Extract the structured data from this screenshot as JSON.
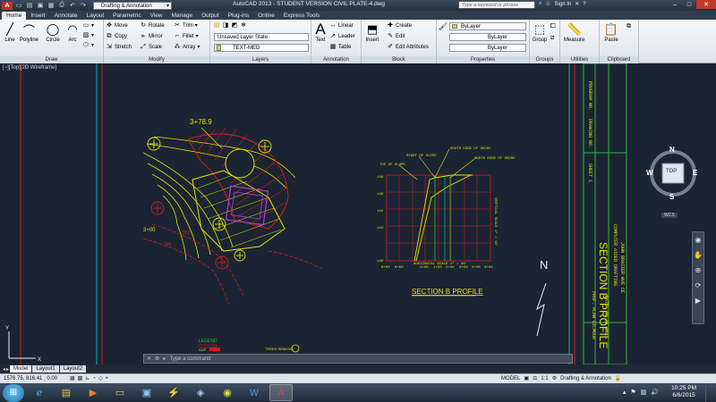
{
  "titlebar": {
    "title": "AutoCAD 2013 - STUDENT VERSION   CIVIL PLATE-4.dwg",
    "workspace": "Drafting & Annotation",
    "search_placeholder": "Type a keyword or phrase",
    "sign_in": "Sign In"
  },
  "tabs": [
    "Home",
    "Insert",
    "Annotate",
    "Layout",
    "Parametric",
    "View",
    "Manage",
    "Output",
    "Plug-ins",
    "Online",
    "Express Tools"
  ],
  "ribbon": {
    "draw": {
      "title": "Draw",
      "line": "Line",
      "polyline": "Polyline",
      "circle": "Circle",
      "arc": "Arc"
    },
    "modify": {
      "title": "Modify",
      "move": "Move",
      "rotate": "Rotate",
      "trim": "Trim",
      "copy": "Copy",
      "mirror": "Mirror",
      "fillet": "Fillet",
      "stretch": "Stretch",
      "scale": "Scale",
      "array": "Array"
    },
    "layers": {
      "title": "Layers",
      "state": "Unsaved Layer State",
      "current": "TEXT-MED"
    },
    "annotation": {
      "title": "Annotation",
      "text": "Text",
      "linear": "Linear",
      "leader": "Leader",
      "table": "Table"
    },
    "block": {
      "title": "Block",
      "insert": "Insert",
      "create": "Create",
      "edit": "Edit",
      "edit_attributes": "Edit Attributes"
    },
    "properties": {
      "title": "Properties",
      "color": "ByLayer",
      "linetype": "ByLayer",
      "lineweight": "ByLayer"
    },
    "groups": {
      "title": "Groups",
      "group": "Group"
    },
    "utilities": {
      "title": "Utilities",
      "measure": "Measure"
    },
    "clipboard": {
      "title": "Clipboard",
      "paste": "Paste"
    }
  },
  "viewport": {
    "label": "[−][Top][2D Wireframe]",
    "navcube": {
      "top": "TOP",
      "n": "N",
      "s": "S",
      "e": "E",
      "w": "W",
      "wcs": "WCS"
    }
  },
  "drawing": {
    "station_label": "3+78.9",
    "station_label2": "3+00",
    "sample_label1": "350",
    "sample_label2": "340",
    "section_title": "SECTION  B  PROFILE",
    "callout1": "START OF SLOPE",
    "callout2": "SOUTH EDGE OF HOUSE",
    "callout3": "NORTH EDGE OF HOUSE",
    "callout4": "TOE OF SLOPE",
    "scale_text": "HORIZONTAL SCALE  1\" = 40'",
    "vert_scale_text": "VERTICAL SCALE 1\" = 10'",
    "x_ticks": [
      "0+00",
      "0+50",
      "1+00",
      "1+50",
      "2+00",
      "2+50",
      "3+00",
      "3+50"
    ],
    "y_ticks": [
      "148",
      "146",
      "144",
      "142",
      "140"
    ],
    "north": "N",
    "legend_title": "LEGEND",
    "legend_cut": "CUT",
    "legend_fill": "FILL",
    "trees_label": "TREES REMOVE",
    "contour_label": "CONTOUR",
    "titleblock_big": "SECTION  B  PROFILE",
    "titleblock_lines": [
      "PROGRAM NO.",
      "DRAWING NO.",
      "SHEET 1",
      "PROF. ALAN GILMOUR",
      "JOHN BRASIER WVE CE",
      "DATE: 06-01-2015",
      "COMPUTER AIDED DRAFTING"
    ]
  },
  "layouts": [
    "Model",
    "Layout1",
    "Layout2"
  ],
  "command": {
    "placeholder": "Type a command"
  },
  "status": {
    "coords": "1576.75, 816.41 , 0.00",
    "model": "MODEL",
    "scale": "1:1",
    "workspace": "Drafting & Annotation"
  },
  "taskbar": {
    "time": "10:25 PM",
    "date": "6/6/2015"
  },
  "colors": {
    "accent": "#e5e500",
    "red": "#d81818",
    "cyan": "#19a8b8",
    "green": "#2dba34",
    "bg": "#1b2433"
  }
}
